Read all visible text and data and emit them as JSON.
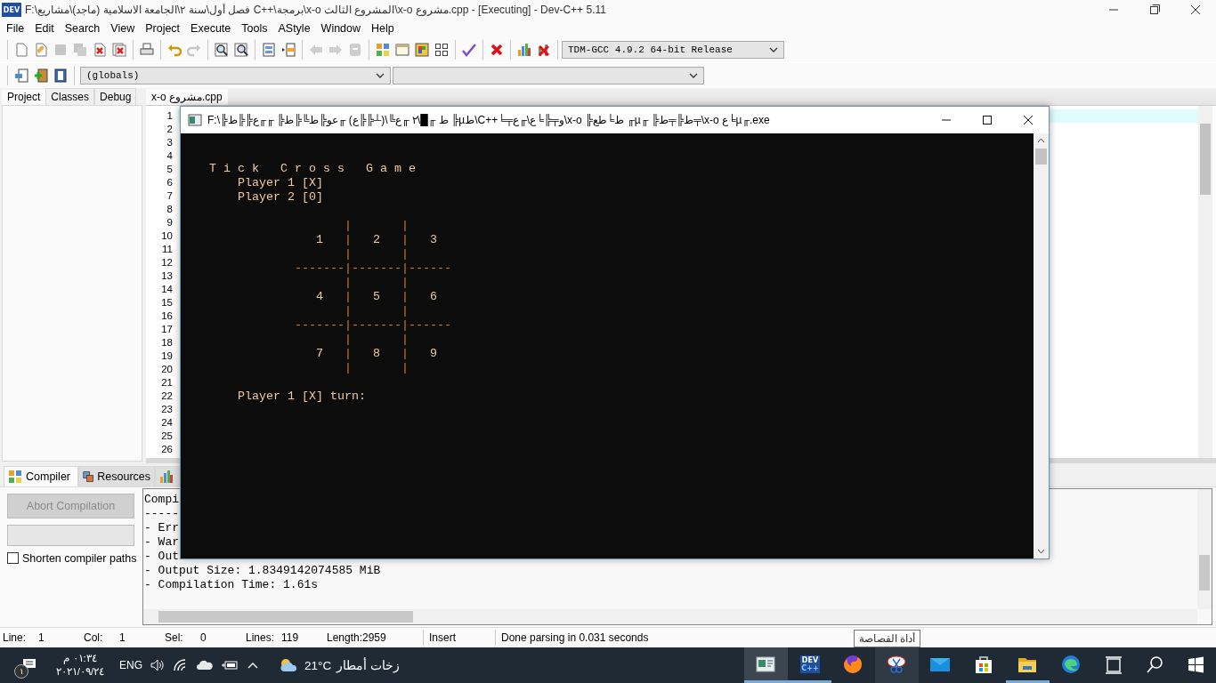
{
  "window": {
    "logo": "DEV",
    "title": "F:\\فصل أول\\سنة ٢\\الجامعة الاسلامية (ماجد)\\مشاريع C++\\برمجة\\x-o المشروع الثالث\\x-o مشروع.cpp - [Executing] - Dev-C++ 5.11"
  },
  "menu": [
    "File",
    "Edit",
    "Search",
    "View",
    "Project",
    "Execute",
    "Tools",
    "AStyle",
    "Window",
    "Help"
  ],
  "toolbar": {
    "groups": [
      [
        {
          "disabled": false
        },
        {
          "disabled": false
        },
        {
          "disabled": true
        },
        {
          "disabled": true
        },
        {
          "disabled": false
        },
        {
          "disabled": false
        }
      ],
      [
        {
          "disabled": false
        }
      ],
      [
        {
          "disabled": false
        },
        {
          "disabled": true
        }
      ],
      [
        {
          "disabled": false
        },
        {
          "disabled": false
        }
      ],
      [
        {
          "disabled": false
        },
        {
          "disabled": false
        }
      ],
      [
        {
          "disabled": true
        },
        {
          "disabled": true
        },
        {
          "disabled": true
        }
      ],
      [
        {
          "disabled": false
        },
        {
          "disabled": false
        },
        {
          "disabled": false
        },
        {
          "disabled": false
        }
      ],
      [
        {
          "disabled": false
        }
      ],
      [
        {
          "disabled": false
        }
      ],
      [
        {
          "disabled": false
        },
        {
          "disabled": false
        }
      ]
    ],
    "compiler": "TDM-GCC 4.9.2 64-bit Release"
  },
  "toolbar2": {
    "buttons": [
      {
        "disabled": false
      },
      {
        "disabled": false
      },
      {
        "disabled": false
      }
    ],
    "scope": "(globals)"
  },
  "side_tabs": [
    {
      "label": "Project",
      "selected": true
    },
    {
      "label": "Classes",
      "selected": false
    },
    {
      "label": "Debug",
      "selected": false
    }
  ],
  "editor": {
    "tabs": [
      {
        "label": "x-o مشروع.cpp",
        "selected": true
      }
    ],
    "lines": [
      {
        "number": "1",
        "current": true
      },
      {
        "number": "2",
        "current": false
      },
      {
        "number": "3",
        "current": false
      },
      {
        "number": "4",
        "current": false
      },
      {
        "number": "5",
        "current": false
      },
      {
        "number": "6",
        "current": false
      },
      {
        "number": "7",
        "current": false
      },
      {
        "number": "8",
        "current": false
      },
      {
        "number": "9",
        "current": false
      },
      {
        "number": "10",
        "current": false
      },
      {
        "number": "11",
        "current": false
      },
      {
        "number": "12",
        "current": false
      },
      {
        "number": "13",
        "current": false
      },
      {
        "number": "14",
        "current": false
      },
      {
        "number": "15",
        "current": false
      },
      {
        "number": "16",
        "current": false
      },
      {
        "number": "17",
        "current": false
      },
      {
        "number": "18",
        "current": false
      },
      {
        "number": "19",
        "current": false
      },
      {
        "number": "20",
        "current": false
      },
      {
        "number": "21",
        "current": false
      },
      {
        "number": "22",
        "current": false
      },
      {
        "number": "23",
        "current": false
      },
      {
        "number": "24",
        "current": false
      },
      {
        "number": "25",
        "current": false
      },
      {
        "number": "26",
        "current": false
      }
    ]
  },
  "console": {
    "title": "F:\\╠ط ╓█\\٢ ╓ع╚\\(┴╠╠ع) ╓عو╠ط╚╠ط╠ ╓╓ع╠╠ط ╠µط\\C++╘╤و╤╠╘ع\\╓ع\\x-o ╠ط╘طع ╓µ╓ ╠ط╠╤ط╤\\x-o ع╘µ╓.exe",
    "lines": [
      {
        "kind": "blank"
      },
      {
        "kind": "blank"
      },
      {
        "kind": "output",
        "segments": [
          {
            "text": "    T i c k   C r o s s   G a m e",
            "kind": "text"
          }
        ]
      },
      {
        "kind": "output",
        "segments": [
          {
            "text": "        Player 1 [X]",
            "kind": "text"
          }
        ]
      },
      {
        "kind": "output",
        "segments": [
          {
            "text": "        Player 2 [0]",
            "kind": "text"
          }
        ]
      },
      {
        "kind": "blank"
      },
      {
        "kind": "output",
        "segments": [
          {
            "text": "                       |       |",
            "kind": "grid"
          }
        ]
      },
      {
        "kind": "output",
        "segments": [
          {
            "text": "                   1   ",
            "kind": "text"
          },
          {
            "text": "|",
            "kind": "grid"
          },
          {
            "text": "   2   ",
            "kind": "text"
          },
          {
            "text": "|",
            "kind": "grid"
          },
          {
            "text": "   3",
            "kind": "text"
          }
        ]
      },
      {
        "kind": "output",
        "segments": [
          {
            "text": "                       |       |",
            "kind": "grid"
          }
        ]
      },
      {
        "kind": "output",
        "segments": [
          {
            "text": "                -------|-------|------",
            "kind": "grid"
          }
        ]
      },
      {
        "kind": "output",
        "segments": [
          {
            "text": "                       |       |",
            "kind": "grid"
          }
        ]
      },
      {
        "kind": "output",
        "segments": [
          {
            "text": "                   4   ",
            "kind": "text"
          },
          {
            "text": "|",
            "kind": "grid"
          },
          {
            "text": "   5   ",
            "kind": "text"
          },
          {
            "text": "|",
            "kind": "grid"
          },
          {
            "text": "   6",
            "kind": "text"
          }
        ]
      },
      {
        "kind": "output",
        "segments": [
          {
            "text": "                       |       |",
            "kind": "grid"
          }
        ]
      },
      {
        "kind": "output",
        "segments": [
          {
            "text": "                -------|-------|------",
            "kind": "grid"
          }
        ]
      },
      {
        "kind": "output",
        "segments": [
          {
            "text": "                       |       |",
            "kind": "grid"
          }
        ]
      },
      {
        "kind": "output",
        "segments": [
          {
            "text": "                   7   ",
            "kind": "text"
          },
          {
            "text": "|",
            "kind": "grid"
          },
          {
            "text": "   8   ",
            "kind": "text"
          },
          {
            "text": "|",
            "kind": "grid"
          },
          {
            "text": "   9",
            "kind": "text"
          }
        ]
      },
      {
        "kind": "output",
        "segments": [
          {
            "text": "                       |       |",
            "kind": "grid"
          }
        ]
      },
      {
        "kind": "blank"
      },
      {
        "kind": "output",
        "segments": [
          {
            "text": "        Player 1 [X] turn:",
            "kind": "text"
          }
        ]
      }
    ]
  },
  "bottom_tabs": [
    {
      "label": "Compiler",
      "selected": true
    },
    {
      "label": "Resources",
      "selected": false
    },
    {
      "selected": false
    }
  ],
  "compiler_panel": {
    "abort_button": {
      "label": "Abort Compilation",
      "disabled": true
    },
    "progress": {
      "level": 0
    },
    "shorten_paths": {
      "label": "Shorten compiler paths",
      "checked": false
    },
    "log": [
      "Compi",
      "-----",
      "- Err",
      "- War",
      "- Out",
      "- Output Size: 1.8349142074585 MiB",
      "- Compilation Time: 1.61s"
    ]
  },
  "status_bar": {
    "fields": [
      {
        "label": "Line:",
        "value": "1"
      },
      {
        "label": "Col:",
        "value": "1"
      },
      {
        "label": "Sel:",
        "value": "0"
      },
      {
        "label": "Lines:",
        "value": "119"
      },
      {
        "label": "Length:",
        "value": "2959"
      }
    ],
    "mode": "Insert",
    "message": "Done parsing in 0.031 seconds"
  },
  "tooltip": "أداة القصاصة",
  "taskbar": {
    "tray": {
      "notifications": "١",
      "time": "٠١:٣٤ م",
      "date": "٢٠٢١/٠٩/٢٤",
      "language": "ENG",
      "temperature": "21°C",
      "weather": "زخات أمطار"
    },
    "apps": [
      {
        "running": true,
        "active": true,
        "hovered": false
      },
      {
        "running": true,
        "active": false,
        "hovered": false,
        "logo_lines": [
          "DEV",
          "C++"
        ]
      },
      {
        "running": false,
        "active": false,
        "hovered": false
      },
      {
        "running": false,
        "active": false,
        "hovered": true
      },
      {
        "running": false,
        "active": false,
        "hovered": false
      },
      {
        "running": false,
        "active": false,
        "hovered": false
      },
      {
        "running": true,
        "active": false,
        "hovered": false
      },
      {
        "running": false,
        "active": false,
        "hovered": false
      }
    ]
  }
}
